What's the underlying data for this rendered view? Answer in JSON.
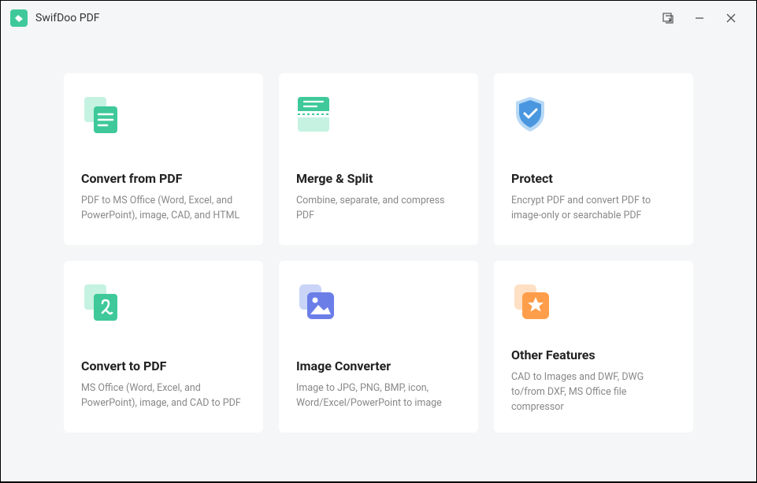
{
  "app": {
    "title": "SwifDoo PDF"
  },
  "cards": [
    {
      "title": "Convert from PDF",
      "desc": "PDF to MS Office (Word, Excel, and PowerPoint), image, CAD, and HTML"
    },
    {
      "title": "Merge & Split",
      "desc": "Combine, separate, and compress PDF"
    },
    {
      "title": "Protect",
      "desc": "Encrypt PDF and convert PDF to image-only or searchable PDF"
    },
    {
      "title": "Convert to PDF",
      "desc": "MS Office (Word, Excel, and PowerPoint), image, and CAD to PDF"
    },
    {
      "title": "Image Converter",
      "desc": "Image to JPG, PNG, BMP, icon, Word/Excel/PowerPoint to image"
    },
    {
      "title": "Other Features",
      "desc": "CAD to Images and DWF, DWG to/from DXF, MS Office file compressor"
    }
  ]
}
